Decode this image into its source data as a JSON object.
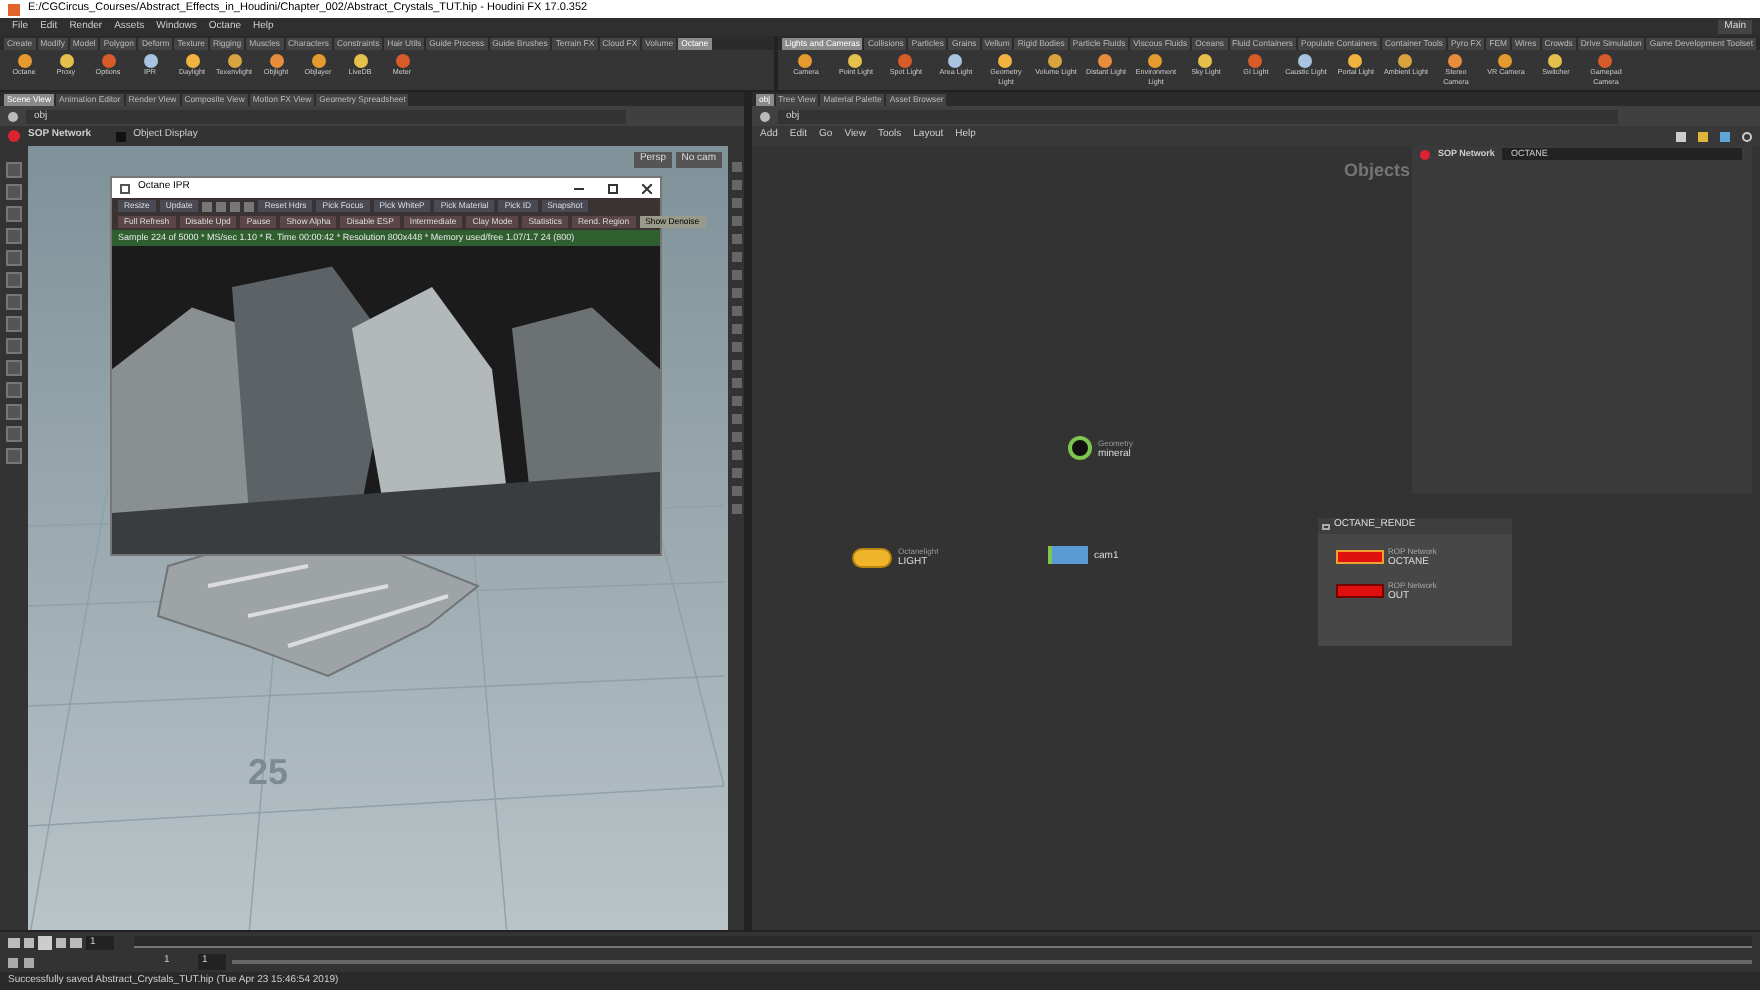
{
  "window": {
    "title": "E:/CGCircus_Courses/Abstract_Effects_in_Houdini/Chapter_002/Abstract_Crystals_TUT.hip - Houdini FX 17.0.352"
  },
  "menu_bar": {
    "items": [
      "File",
      "Edit",
      "Render",
      "Assets",
      "Windows",
      "Octane",
      "Help"
    ],
    "build": "Main"
  },
  "shelf_left": {
    "tabs": [
      {
        "label": "Create",
        "selected": false
      },
      {
        "label": "Modify",
        "selected": false
      },
      {
        "label": "Model",
        "selected": false
      },
      {
        "label": "Polygon",
        "selected": false
      },
      {
        "label": "Deform",
        "selected": false
      },
      {
        "label": "Texture",
        "selected": false
      },
      {
        "label": "Rigging",
        "selected": false
      },
      {
        "label": "Muscles",
        "selected": false
      },
      {
        "label": "Characters",
        "selected": false
      },
      {
        "label": "Constraints",
        "selected": false
      },
      {
        "label": "Hair Utils",
        "selected": false
      },
      {
        "label": "Guide Process",
        "selected": false
      },
      {
        "label": "Guide Brushes",
        "selected": false
      },
      {
        "label": "Terrain FX",
        "selected": false
      },
      {
        "label": "Cloud FX",
        "selected": false
      },
      {
        "label": "Volume",
        "selected": false
      },
      {
        "label": "Octane",
        "selected": true
      }
    ],
    "tools": [
      "Octane",
      "Proxy",
      "Options",
      "IPR",
      "Daylight",
      "Texenvlight",
      "Objlight",
      "Objlayer",
      "LiveDB",
      "Meter"
    ]
  },
  "shelf_right": {
    "tabs": [
      {
        "label": "Lights and Cameras",
        "selected": true
      },
      {
        "label": "Collisions",
        "selected": false
      },
      {
        "label": "Particles",
        "selected": false
      },
      {
        "label": "Grains",
        "selected": false
      },
      {
        "label": "Vellum",
        "selected": false
      },
      {
        "label": "Rigid Bodies",
        "selected": false
      },
      {
        "label": "Particle Fluids",
        "selected": false
      },
      {
        "label": "Viscous Fluids",
        "selected": false
      },
      {
        "label": "Oceans",
        "selected": false
      },
      {
        "label": "Fluid Containers",
        "selected": false
      },
      {
        "label": "Populate Containers",
        "selected": false
      },
      {
        "label": "Container Tools",
        "selected": false
      },
      {
        "label": "Pyro FX",
        "selected": false
      },
      {
        "label": "FEM",
        "selected": false
      },
      {
        "label": "Wires",
        "selected": false
      },
      {
        "label": "Crowds",
        "selected": false
      },
      {
        "label": "Drive Simulation",
        "selected": false
      },
      {
        "label": "Game Development Toolset",
        "selected": false
      }
    ],
    "tools": [
      "Camera",
      "Point Light",
      "Spot Light",
      "Area Light",
      "Geometry Light",
      "Volume Light",
      "Distant Light",
      "Environment Light",
      "Sky Light",
      "GI Light",
      "Caustic Light",
      "Portal Light",
      "Ambient Light",
      "Stereo Camera",
      "VR Camera",
      "Switcher",
      "Gamepad Camera"
    ]
  },
  "left_pane": {
    "tabs": [
      {
        "label": "Scene View",
        "selected": true
      },
      {
        "label": "Animation Editor",
        "selected": false
      },
      {
        "label": "Render View",
        "selected": false
      },
      {
        "label": "Composite View",
        "selected": false
      },
      {
        "label": "Motion FX View",
        "selected": false
      },
      {
        "label": "Geometry Spreadsheet",
        "selected": false
      }
    ],
    "path": "obj",
    "network_label": "SOP Network",
    "display_label": "Object Display",
    "camera": "Persp",
    "camera_menu": "No cam",
    "grid_label": "25"
  },
  "ipr": {
    "title": "Octane IPR",
    "row1": [
      "Resize",
      "Update",
      "Reset Hdrs",
      "Pick Focus",
      "Pick WhiteP",
      "Pick Material",
      "Pick ID",
      "Snapshot"
    ],
    "row2": [
      {
        "label": "Full Refresh",
        "selected": false
      },
      {
        "label": "Disable Upd",
        "selected": false
      },
      {
        "label": "Pause",
        "selected": false
      },
      {
        "label": "Show Alpha",
        "selected": false
      },
      {
        "label": "Disable ESP",
        "selected": false
      },
      {
        "label": "Intermediate",
        "selected": false
      },
      {
        "label": "Clay Mode",
        "selected": false
      },
      {
        "label": "Statistics",
        "selected": false
      },
      {
        "label": "Rend. Region",
        "selected": false
      },
      {
        "label": "Show Denoise",
        "selected": true
      }
    ],
    "status": "Sample 224 of 5000 * MS/sec 1.10 * R. Time 00:00:42 * Resolution 800x448 * Memory used/free 1.07/1.7 24 (800)"
  },
  "right_pane": {
    "tabs": [
      {
        "label": "obj",
        "selected": true
      },
      {
        "label": "Tree View",
        "selected": false
      },
      {
        "label": "Material Palette",
        "selected": false
      },
      {
        "label": "Asset Browser",
        "selected": false
      }
    ],
    "path": "obj",
    "menu": [
      "Add",
      "Edit",
      "Go",
      "View",
      "Tools",
      "Layout",
      "Help"
    ],
    "context": "Objects",
    "network_label": "SOP Network",
    "network_value": "OCTANE"
  },
  "nodes": [
    {
      "kind": "geometry",
      "type_label": "Geometry",
      "name": "mineral"
    },
    {
      "kind": "light",
      "type_label": "Octanelight",
      "name": "LIGHT"
    },
    {
      "kind": "camera",
      "name": "cam1"
    }
  ],
  "network_box": {
    "title": "OCTANE_RENDE",
    "nodes": [
      {
        "type_label": "ROP Network",
        "name": "OCTANE",
        "selected": true
      },
      {
        "type_label": "ROP Network",
        "name": "OUT",
        "selected": false
      }
    ]
  },
  "timeline": {
    "frame": "1",
    "start": "1",
    "end": "1"
  },
  "status_bar": "Successfully saved Abstract_Crystals_TUT.hip (Tue Apr 23 15:46:54 2019)"
}
